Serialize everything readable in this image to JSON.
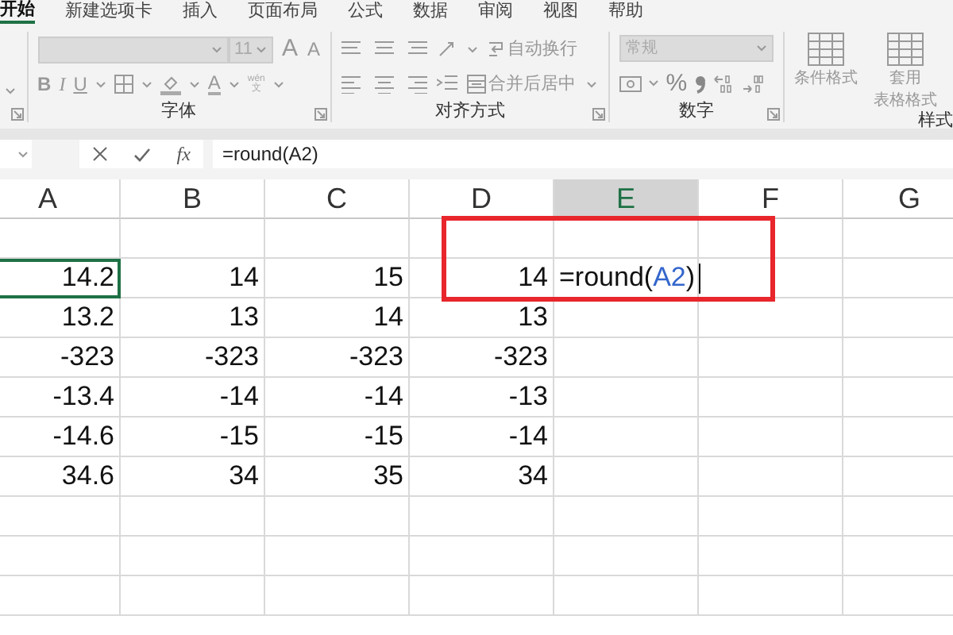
{
  "tabs": [
    {
      "label": "开始",
      "selected": true
    },
    {
      "label": "新建选项卡",
      "selected": false
    },
    {
      "label": "插入",
      "selected": false
    },
    {
      "label": "页面布局",
      "selected": false
    },
    {
      "label": "公式",
      "selected": false
    },
    {
      "label": "数据",
      "selected": false
    },
    {
      "label": "审阅",
      "selected": false
    },
    {
      "label": "视图",
      "selected": false
    },
    {
      "label": "帮助",
      "selected": false
    }
  ],
  "font_group": {
    "label": "字体",
    "font_size": "11",
    "grow": "A",
    "shrink": "A",
    "styles": [
      "B",
      "I",
      "U"
    ],
    "font_color": "A",
    "phonetic_top": "wén",
    "phonetic_bottom": "文"
  },
  "alignment_group": {
    "label": "对齐方式",
    "wrap_text": "自动换行",
    "merge_center": "合并后居中"
  },
  "number_group": {
    "label": "数字",
    "format": "常规",
    "percent": "%"
  },
  "styles_group": {
    "label": "样式",
    "buttons": [
      {
        "lines": [
          "条件格式"
        ]
      },
      {
        "lines": [
          "套用",
          "表格格式"
        ]
      }
    ]
  },
  "formula_bar": {
    "fx": "fx",
    "formula": "=round(A2)"
  },
  "columns": [
    {
      "label": "A",
      "selected": false
    },
    {
      "label": "B",
      "selected": false
    },
    {
      "label": "C",
      "selected": false
    },
    {
      "label": "D",
      "selected": false
    },
    {
      "label": "E",
      "selected": true
    },
    {
      "label": "F",
      "selected": false
    },
    {
      "label": "G",
      "selected": false
    }
  ],
  "rows": [
    {
      "cells": [
        {
          "kind": "value",
          "value": "14.2",
          "selected": true
        },
        {
          "kind": "value",
          "value": "14",
          "selected": false
        },
        {
          "kind": "value",
          "value": "15",
          "selected": false
        },
        {
          "kind": "value",
          "value": "14",
          "selected": false
        },
        {
          "kind": "edit",
          "before": "=round(",
          "ref": "A2",
          "after": ")",
          "selected": false
        }
      ]
    },
    {
      "cells": [
        {
          "kind": "value",
          "value": "13.2",
          "selected": false
        },
        {
          "kind": "value",
          "value": "13",
          "selected": false
        },
        {
          "kind": "value",
          "value": "14",
          "selected": false
        },
        {
          "kind": "value",
          "value": "13",
          "selected": false
        }
      ]
    },
    {
      "cells": [
        {
          "kind": "value",
          "value": "-323",
          "selected": false
        },
        {
          "kind": "value",
          "value": "-323",
          "selected": false
        },
        {
          "kind": "value",
          "value": "-323",
          "selected": false
        },
        {
          "kind": "value",
          "value": "-323",
          "selected": false
        }
      ]
    },
    {
      "cells": [
        {
          "kind": "value",
          "value": "-13.4",
          "selected": false
        },
        {
          "kind": "value",
          "value": "-14",
          "selected": false
        },
        {
          "kind": "value",
          "value": "-14",
          "selected": false
        },
        {
          "kind": "value",
          "value": "-13",
          "selected": false
        }
      ]
    },
    {
      "cells": [
        {
          "kind": "value",
          "value": "-14.6",
          "selected": false
        },
        {
          "kind": "value",
          "value": "-15",
          "selected": false
        },
        {
          "kind": "value",
          "value": "-15",
          "selected": false
        },
        {
          "kind": "value",
          "value": "-14",
          "selected": false
        }
      ]
    },
    {
      "cells": [
        {
          "kind": "value",
          "value": "34.6",
          "selected": false
        },
        {
          "kind": "value",
          "value": "34",
          "selected": false
        },
        {
          "kind": "value",
          "value": "35",
          "selected": false
        },
        {
          "kind": "value",
          "value": "34",
          "selected": false
        }
      ]
    }
  ],
  "highlight": {
    "color": "#e8262c"
  }
}
